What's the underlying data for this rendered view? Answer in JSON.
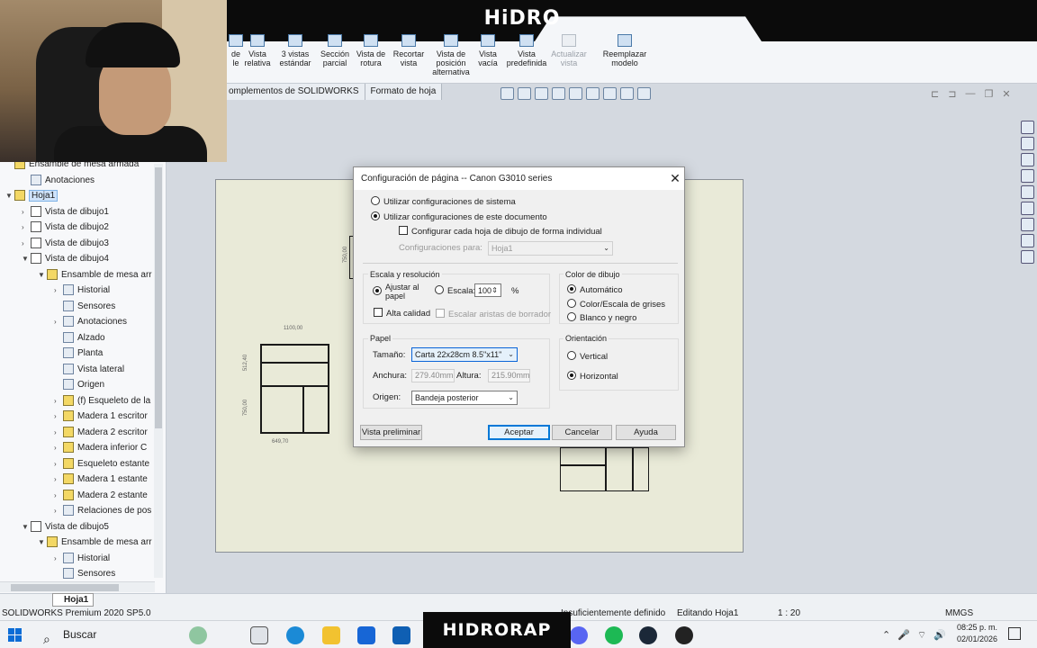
{
  "watermark": {
    "top_logo": "HiDRO",
    "bottom_banner": "HIDRORAP"
  },
  "ribbon": {
    "buttons": [
      {
        "label": "de\nle"
      },
      {
        "label": "Vista\nrelativa"
      },
      {
        "label": "3 vistas\nestándar"
      },
      {
        "label": "Sección\nparcial"
      },
      {
        "label": "Vista de\nrotura"
      },
      {
        "label": "Recortar\nvista"
      },
      {
        "label": "Vista de\nposición\nalternativa"
      },
      {
        "label": "Vista\nvacía"
      },
      {
        "label": "Vista\npredefinida"
      },
      {
        "label": "Actualizar\nvista"
      },
      {
        "label": "Reemplazar\nmodelo"
      }
    ],
    "tabs": [
      "omplementos de SOLIDWORKS",
      "Formato de hoja"
    ]
  },
  "tree": {
    "items": [
      {
        "label": "Ensamble de mesa armada",
        "depth": 0,
        "arrow": "",
        "icon": "assembly"
      },
      {
        "label": "Anotaciones",
        "depth": 1,
        "arrow": "",
        "icon": "annotation"
      },
      {
        "label": "Hoja1",
        "depth": 0,
        "arrow": "▼",
        "icon": "sheet",
        "selected": true
      },
      {
        "label": "Vista de dibujo1",
        "depth": 1,
        "arrow": "›",
        "icon": "view"
      },
      {
        "label": "Vista de dibujo2",
        "depth": 1,
        "arrow": "›",
        "icon": "view"
      },
      {
        "label": "Vista de dibujo3",
        "depth": 1,
        "arrow": "›",
        "icon": "view"
      },
      {
        "label": "Vista de dibujo4",
        "depth": 1,
        "arrow": "▼",
        "icon": "view"
      },
      {
        "label": "Ensamble de mesa arr",
        "depth": 2,
        "arrow": "▼",
        "icon": "assembly"
      },
      {
        "label": "Historial",
        "depth": 3,
        "arrow": "›",
        "icon": "plain"
      },
      {
        "label": "Sensores",
        "depth": 3,
        "arrow": "",
        "icon": "plain"
      },
      {
        "label": "Anotaciones",
        "depth": 3,
        "arrow": "›",
        "icon": "plain"
      },
      {
        "label": "Alzado",
        "depth": 3,
        "arrow": "",
        "icon": "plain"
      },
      {
        "label": "Planta",
        "depth": 3,
        "arrow": "",
        "icon": "plain"
      },
      {
        "label": "Vista lateral",
        "depth": 3,
        "arrow": "",
        "icon": "plain"
      },
      {
        "label": "Origen",
        "depth": 3,
        "arrow": "",
        "icon": "plain"
      },
      {
        "label": "(f) Esqueleto de la",
        "depth": 3,
        "arrow": "›",
        "icon": "part"
      },
      {
        "label": "Madera 1 escritor",
        "depth": 3,
        "arrow": "›",
        "icon": "part"
      },
      {
        "label": "Madera 2 escritor",
        "depth": 3,
        "arrow": "›",
        "icon": "part"
      },
      {
        "label": "Madera inferior C",
        "depth": 3,
        "arrow": "›",
        "icon": "part"
      },
      {
        "label": "Esqueleto estante",
        "depth": 3,
        "arrow": "›",
        "icon": "part"
      },
      {
        "label": "Madera 1 estante",
        "depth": 3,
        "arrow": "›",
        "icon": "part"
      },
      {
        "label": "Madera 2 estante",
        "depth": 3,
        "arrow": "›",
        "icon": "part"
      },
      {
        "label": "Relaciones de pos",
        "depth": 3,
        "arrow": "›",
        "icon": "plain"
      },
      {
        "label": "Vista de dibujo5",
        "depth": 1,
        "arrow": "▼",
        "icon": "view"
      },
      {
        "label": "Ensamble de mesa arr",
        "depth": 2,
        "arrow": "▼",
        "icon": "assembly"
      },
      {
        "label": "Historial",
        "depth": 3,
        "arrow": "›",
        "icon": "plain"
      },
      {
        "label": "Sensores",
        "depth": 3,
        "arrow": "",
        "icon": "plain"
      }
    ]
  },
  "drawing": {
    "dims": {
      "top": "1100,00",
      "left_a": "512,40",
      "left_b": "750,00",
      "bottom": "649,70",
      "small": "750,00"
    }
  },
  "dialog": {
    "title": "Configuración de página -- Canon G3010 series",
    "use_system": "Utilizar configuraciones de sistema",
    "use_document": "Utilizar configuraciones de este documento",
    "per_sheet": "Configurar cada hoja de dibujo de forma individual",
    "settings_for_label": "Configuraciones para:",
    "settings_for_value": "Hoja1",
    "scale_group": "Escala y resolución",
    "fit_to_paper": "Ajustar al\npapel",
    "scale_label": "Escala:",
    "scale_value": "100",
    "scale_unit": "%",
    "high_quality": "Alta calidad",
    "scale_borders": "Escalar aristas de borrador",
    "color_group": "Color de dibujo",
    "color_auto": "Automático",
    "color_gray": "Color/Escala de grises",
    "color_bw": "Blanco y negro",
    "paper_group": "Papel",
    "size_label": "Tamaño:",
    "size_value": "Carta 22x28cm 8.5\"x11\"",
    "width_label": "Anchura:",
    "width_value": "279.40mm",
    "height_label": "Altura:",
    "height_value": "215.90mm",
    "source_label": "Origen:",
    "source_value": "Bandeja posterior",
    "orientation_group": "Orientación",
    "orient_vertical": "Vertical",
    "orient_horizontal": "Horizontal",
    "preview_button": "Vista preliminar",
    "ok_button": "Aceptar",
    "cancel_button": "Cancelar",
    "help_button": "Ayuda"
  },
  "status": {
    "app": "SOLIDWORKS Premium 2020 SP5.0",
    "definition": "Insuficientemente definido",
    "editing": "Editando Hoja1",
    "scale": "1 : 20",
    "units": "MMGS"
  },
  "sheet_tab": "Hoja1",
  "taskbar": {
    "search": "Buscar",
    "time": "08:25 p. m.",
    "date": "02/01/2026"
  }
}
